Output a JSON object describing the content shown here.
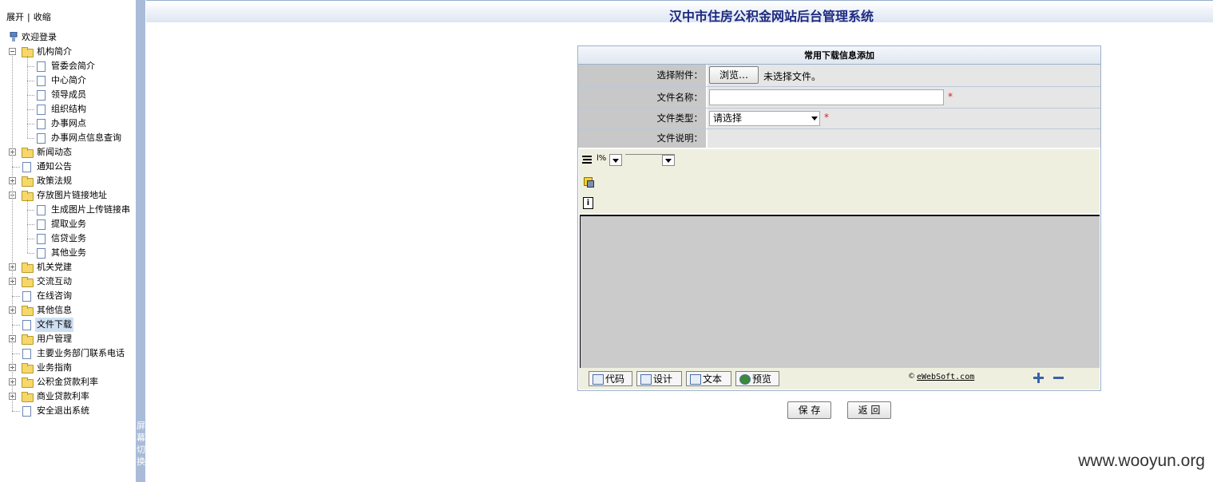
{
  "left_panel": {
    "expand_label": "展开",
    "collapse_label": "收缩",
    "separator": "|",
    "tree": [
      {
        "label": "欢迎登录",
        "icon": "home-icon",
        "level": 0,
        "type": "root"
      },
      {
        "label": "机构简介",
        "icon": "folder-open-icon",
        "level": 0,
        "type": "folder",
        "expanded": true
      },
      {
        "label": "管委会简介",
        "icon": "page-icon",
        "level": 1,
        "type": "page"
      },
      {
        "label": "中心简介",
        "icon": "page-icon",
        "level": 1,
        "type": "page"
      },
      {
        "label": "领导成员",
        "icon": "page-icon",
        "level": 1,
        "type": "page"
      },
      {
        "label": "组织结构",
        "icon": "page-icon",
        "level": 1,
        "type": "page"
      },
      {
        "label": "办事网点",
        "icon": "page-icon",
        "level": 1,
        "type": "page"
      },
      {
        "label": "办事网点信息查询",
        "icon": "page-icon",
        "level": 1,
        "type": "page"
      },
      {
        "label": "新闻动态",
        "icon": "folder-icon",
        "level": 0,
        "type": "folder",
        "expanded": false
      },
      {
        "label": "通知公告",
        "icon": "page-icon",
        "level": 0,
        "type": "page"
      },
      {
        "label": "政策法规",
        "icon": "folder-icon",
        "level": 0,
        "type": "folder",
        "expanded": false
      },
      {
        "label": "存放图片链接地址",
        "icon": "folder-open-icon",
        "level": 0,
        "type": "folder",
        "expanded": true
      },
      {
        "label": "生成图片上传链接串",
        "icon": "page-icon",
        "level": 1,
        "type": "page"
      },
      {
        "label": "提取业务",
        "icon": "page-icon",
        "level": 1,
        "type": "page"
      },
      {
        "label": "信贷业务",
        "icon": "page-icon",
        "level": 1,
        "type": "page"
      },
      {
        "label": "其他业务",
        "icon": "page-icon",
        "level": 1,
        "type": "page"
      },
      {
        "label": "机关党建",
        "icon": "folder-icon",
        "level": 0,
        "type": "folder",
        "expanded": false
      },
      {
        "label": "交流互动",
        "icon": "folder-icon",
        "level": 0,
        "type": "folder",
        "expanded": false
      },
      {
        "label": "在线咨询",
        "icon": "page-icon",
        "level": 0,
        "type": "page"
      },
      {
        "label": "其他信息",
        "icon": "folder-icon",
        "level": 0,
        "type": "folder",
        "expanded": false
      },
      {
        "label": "文件下载",
        "icon": "page-icon",
        "level": 0,
        "type": "page",
        "selected": true
      },
      {
        "label": "用户管理",
        "icon": "folder-icon",
        "level": 0,
        "type": "folder",
        "expanded": false
      },
      {
        "label": "主要业务部门联系电话",
        "icon": "page-icon",
        "level": 0,
        "type": "page"
      },
      {
        "label": "业务指南",
        "icon": "folder-icon",
        "level": 0,
        "type": "folder",
        "expanded": false
      },
      {
        "label": "公积金贷款利率",
        "icon": "folder-icon",
        "level": 0,
        "type": "folder",
        "expanded": false
      },
      {
        "label": "商业贷款利率",
        "icon": "folder-icon",
        "level": 0,
        "type": "folder",
        "expanded": false
      },
      {
        "label": "安全退出系统",
        "icon": "page-icon",
        "level": 0,
        "type": "page"
      }
    ]
  },
  "splitter": {
    "label": "屏幕切换"
  },
  "header": {
    "title": "汉中市住房公积金网站后台管理系统"
  },
  "form": {
    "title": "常用下载信息添加",
    "attachment_label": "选择附件：",
    "browse_button": "浏览…",
    "no_file_text": "未选择文件。",
    "name_label": "文件名称：",
    "name_value": "",
    "type_label": "文件类型：",
    "type_selected": "请选择",
    "desc_label": "文件说明：",
    "required_mark": "*"
  },
  "editor": {
    "zoom_value": "l%",
    "footer_buttons": [
      "代码",
      "设计",
      "文本",
      "预览"
    ],
    "brand": "eWebSoft.com",
    "copyright_symbol": "©"
  },
  "actions": {
    "save_label": "保 存",
    "back_label": "返 回"
  },
  "watermark": "www.wooyun.org",
  "colors": {
    "header_title": "#1e2a80",
    "splitter": "#a9bbd8",
    "required": "#d21f1f",
    "editor_bg": "#cbcbcb"
  }
}
